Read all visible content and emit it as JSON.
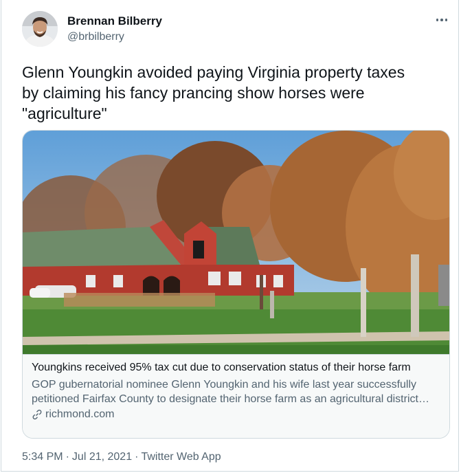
{
  "author": {
    "name": "Brennan Bilberry",
    "handle": "@brbilberry"
  },
  "more_label": "More",
  "tweet": {
    "text": "Glenn Youngkin avoided paying Virginia property taxes\nby claiming his fancy prancing show horses were\n\"agriculture\""
  },
  "card": {
    "title": "Youngkins received 95% tax cut due to conservation status of their horse farm",
    "description": "GOP gubernatorial nominee Glenn Youngkin and his wife last year successfully petitioned Fairfax County to designate their horse farm as an agricultural district…",
    "domain": "richmond.com",
    "icon": "link-icon"
  },
  "meta": {
    "time": "5:34 PM",
    "date": "Jul 21, 2021",
    "separator": "·",
    "source": "Twitter Web App"
  },
  "colors": {
    "text": "#0f1419",
    "secondary": "#536471",
    "border": "#cfd9de",
    "card_bg": "#f7f9f9"
  }
}
